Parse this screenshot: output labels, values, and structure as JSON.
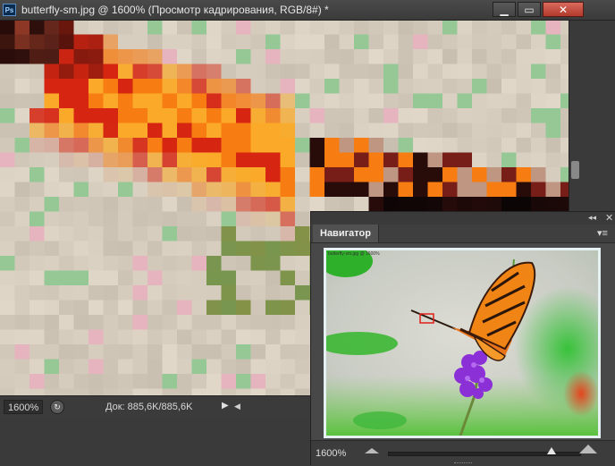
{
  "window": {
    "app_icon": "Ps",
    "title": "butterfly-sm.jpg @ 1600% (Просмотр кадрирования, RGB/8#) *",
    "min_glyph": "▁",
    "max_glyph": "▭",
    "close_glyph": "✕"
  },
  "status_bar": {
    "zoom": "1600%",
    "doc_info": "Док: 885,6K/885,6K",
    "arrow": "▶",
    "scroll_left": "◀"
  },
  "navigator": {
    "tab_label": "Навигатор",
    "collapse_glyph": "◂◂",
    "close_glyph": "✕",
    "menu_glyph": "▾≡",
    "preview_title": "butterfly-sm.jpg @ 1600%",
    "zoom": "1600%",
    "zoom_level": 1600
  },
  "colors": {
    "accent_close": "#c0473a",
    "pixel_background": "#d6cdbf",
    "butterfly_orange": "#f57a12",
    "view_rect": "#e0201a"
  }
}
